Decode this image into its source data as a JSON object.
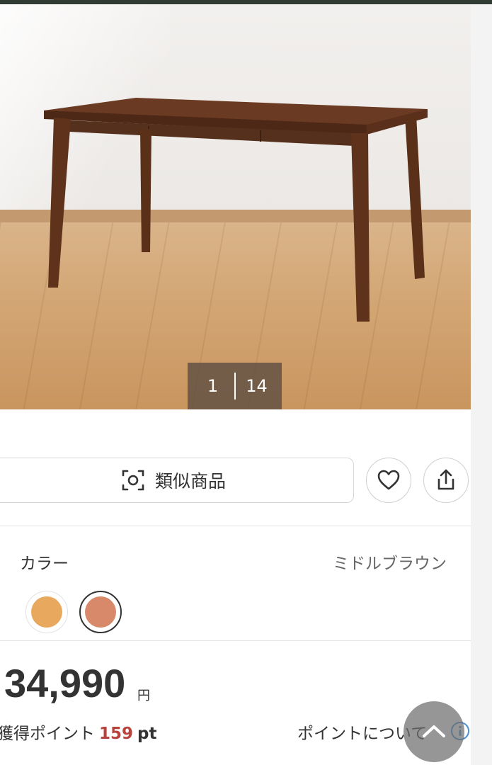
{
  "gallery": {
    "current": "1",
    "total": "14"
  },
  "actions": {
    "similar_label": "類似商品",
    "favorite_icon": "heart-icon",
    "share_icon": "share-icon"
  },
  "color": {
    "label": "カラー",
    "selected": "ミドルブラウン",
    "swatches": [
      {
        "name": "light",
        "hex": "#e8a95e"
      },
      {
        "name": "middle-brown",
        "hex": "#d8896a"
      }
    ]
  },
  "price": {
    "amount": "34,990",
    "currency": "円"
  },
  "points": {
    "label": "獲得ポイント",
    "value": "159",
    "unit": "pt",
    "about_link": "ポイントについて"
  }
}
